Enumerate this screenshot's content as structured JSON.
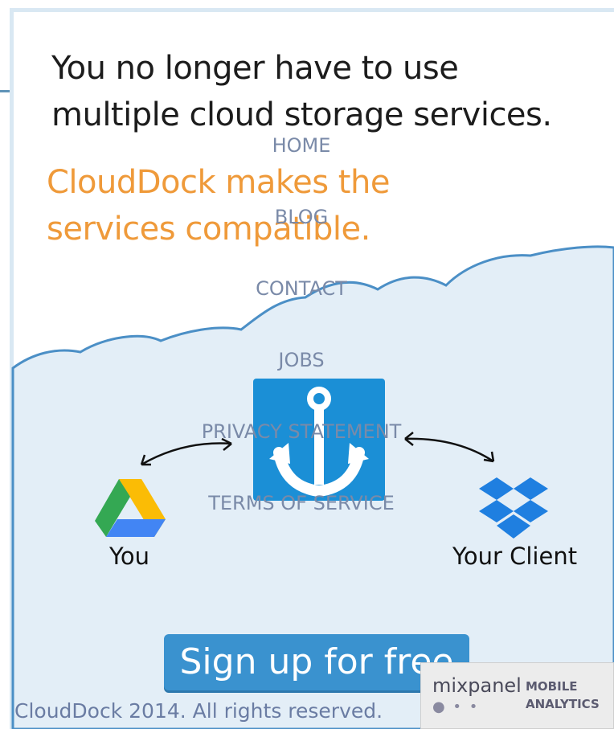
{
  "hero": {
    "headline_line1": "You no longer have to use",
    "headline_line2": "multiple cloud storage services.",
    "sub_line1": "CloudDock makes the",
    "sub_line2": "services compatible."
  },
  "nav": {
    "items": [
      "HOME",
      "BLOG",
      "CONTACT",
      "JOBS",
      "PRIVACY STATEMENT",
      "TERMS OF SERVICE"
    ]
  },
  "diagram": {
    "left_label": "You",
    "right_label": "Your Client",
    "left_icon": "google-drive-icon",
    "center_icon": "anchor-icon",
    "right_icon": "dropbox-icon"
  },
  "cta": {
    "signup_label": "Sign up for free"
  },
  "footer": {
    "copyright": "CloudDock 2014. All rights reserved."
  },
  "badge": {
    "logo": "mixpanel",
    "line1": "MOBILE",
    "line2": "ANALYTICS",
    "dots": "● • •"
  },
  "colors": {
    "accent_orange": "#ef9a3a",
    "brand_blue": "#1b8fd6",
    "cloud_fill": "#e3eef7",
    "cloud_stroke": "#4b8fc6",
    "nav_text": "#7a8aa8"
  }
}
